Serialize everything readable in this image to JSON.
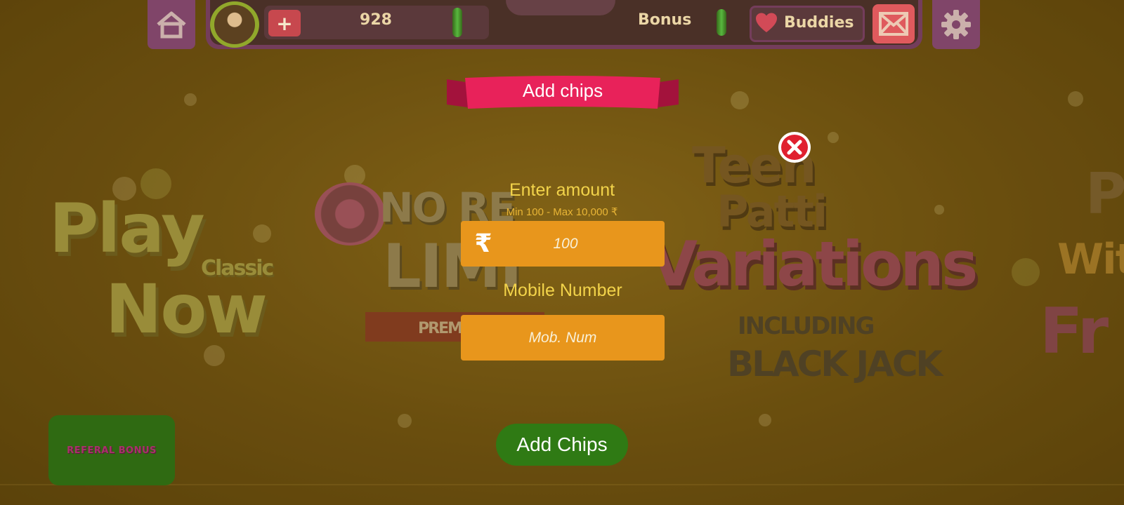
{
  "topbar": {
    "chip_count": "928",
    "bonus_label": "Bonus",
    "buddies_label": "Buddies",
    "plus_label": "+"
  },
  "background_cards": {
    "card1": {
      "line1": "Play",
      "line2": "Now",
      "tag": "Classic"
    },
    "card2": {
      "line1": "NO RE",
      "line2": "LIMI",
      "ribbon": "PREM"
    },
    "card3": {
      "line1": "Teen",
      "line2": "Patti",
      "line3": "Variations",
      "line4": "INCLUDING",
      "line5": "BLACK JACK"
    },
    "card4": {
      "line1": "P",
      "line2": "Wit",
      "line3": "Fr"
    }
  },
  "modal": {
    "title": "Add chips",
    "amount_label": "Enter amount",
    "amount_hint": "Min 100 - Max 10,000 ₹",
    "currency_symbol": "₹",
    "amount_placeholder": "100",
    "mobile_label": "Mobile Number",
    "mobile_placeholder": "Mob. Num",
    "submit_label": "Add Chips"
  },
  "referral": {
    "label": "REFERAL BONUS"
  },
  "colors": {
    "banner": "#e8225a",
    "input_fill": "#e8961c",
    "label_text": "#f2d34a",
    "submit_button": "#2f7a14",
    "close_button": "#e0202f"
  },
  "icons": {
    "home": "home-icon",
    "settings": "gear-icon",
    "mail": "mail-icon",
    "heart": "heart-icon",
    "close": "close-icon",
    "coin": "chip-coin-icon",
    "rupee": "rupee-icon"
  }
}
